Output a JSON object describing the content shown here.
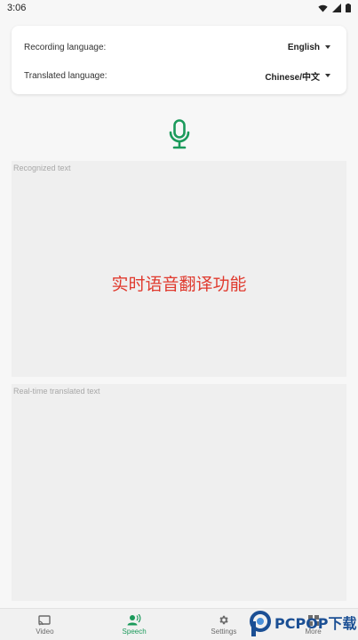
{
  "status_bar": {
    "time": "3:06"
  },
  "settings_card": {
    "recording_label": "Recording language:",
    "recording_value": "English",
    "translated_label": "Translated language:",
    "translated_value": "Chinese/中文"
  },
  "recognized": {
    "placeholder": "Recognized text",
    "content": "实时语音翻译功能"
  },
  "translated": {
    "placeholder": "Real-time translated text"
  },
  "nav": {
    "items": [
      {
        "label": "Video",
        "icon": "cast-icon"
      },
      {
        "label": "Speech",
        "icon": "voice-person-icon"
      },
      {
        "label": "Settings",
        "icon": "gear-icon"
      },
      {
        "label": "More",
        "icon": "grid-icon"
      }
    ]
  },
  "watermark": {
    "brand": "PCPOP下载"
  },
  "colors": {
    "accent": "#1b9a5b",
    "recognized_text": "#e03a2e",
    "panel_bg": "#efefef"
  }
}
